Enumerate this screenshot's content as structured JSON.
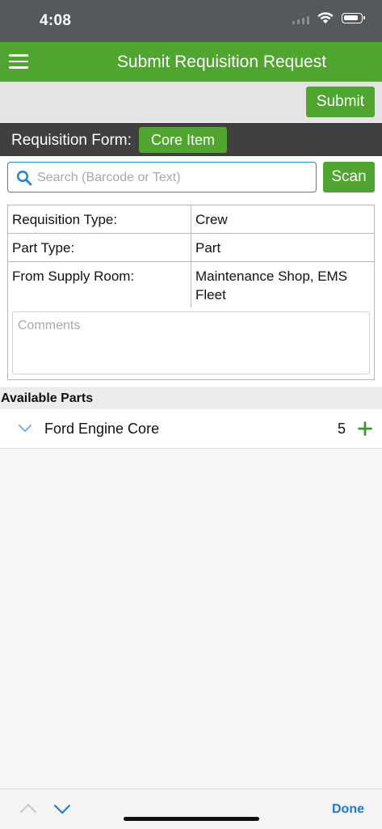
{
  "status_bar": {
    "time": "4:08"
  },
  "header": {
    "title": "Submit Requisition Request"
  },
  "toolbar": {
    "submit_label": "Submit"
  },
  "form_bar": {
    "label": "Requisition Form:",
    "form_type": "Core Item"
  },
  "search": {
    "placeholder": "Search (Barcode or Text)",
    "value": "",
    "scan_label": "Scan"
  },
  "details": [
    {
      "label": "Requisition Type:",
      "value": "Crew"
    },
    {
      "label": "Part Type:",
      "value": "Part"
    },
    {
      "label": "From Supply Room:",
      "value": "Maintenance Shop, EMS Fleet"
    }
  ],
  "comments": {
    "placeholder": "Comments",
    "value": ""
  },
  "available_parts": {
    "title": "Available Parts",
    "items": [
      {
        "name": "Ford Engine Core",
        "quantity": "5"
      }
    ]
  },
  "keyboard_toolbar": {
    "done_label": "Done"
  },
  "colors": {
    "brand_green": "#4fa52f",
    "header_dark": "#404040",
    "link_blue": "#1a7ad8"
  },
  "icons": {
    "menu": "hamburger-menu-icon",
    "search": "search-icon",
    "expand": "chevron-down-icon",
    "add": "plus-icon",
    "previous": "chevron-up-icon",
    "next": "chevron-down-icon"
  }
}
